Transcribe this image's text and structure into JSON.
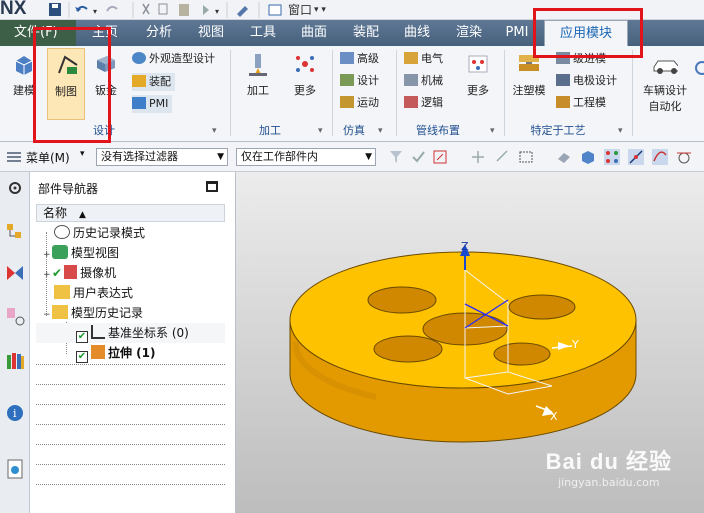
{
  "app": {
    "logo": "NX"
  },
  "quickbar": {
    "window_label": "窗口"
  },
  "tabs": {
    "file": "文件(F)",
    "items": [
      "主页",
      "分析",
      "视图",
      "工具",
      "曲面",
      "装配",
      "曲线",
      "渲染",
      "PMI",
      "应用模块"
    ],
    "active": "应用模块"
  },
  "ribbon": {
    "design_group": {
      "label": "设计",
      "buttons": [
        "建模",
        "制图",
        "钣金"
      ],
      "small": [
        "外观造型设计",
        "装配",
        "PMI"
      ]
    },
    "machining_group": {
      "label": "加工",
      "buttons": [
        "加工",
        "更多"
      ]
    },
    "simulation_group": {
      "label": "仿真",
      "small": [
        "高级",
        "设计",
        "运动"
      ]
    },
    "routing_group": {
      "label": "管线布置",
      "small": [
        "电气",
        "机械",
        "逻辑"
      ],
      "more": "更多"
    },
    "process_group": {
      "label": "特定于工艺",
      "big": "注塑模",
      "small": [
        "级进模",
        "电极设计",
        "工程模"
      ]
    },
    "vehicle": {
      "label_line1": "车辆设计",
      "label_line2": "自动化"
    }
  },
  "selection_bar": {
    "menu_label": "菜单(M)",
    "filter": "没有选择过滤器",
    "scope": "仅在工作部件内"
  },
  "navigator": {
    "title": "部件导航器",
    "column_name": "名称",
    "rows": [
      "历史记录模式",
      "模型视图",
      "摄像机",
      "用户表达式",
      "模型历史记录",
      "基准坐标系 (0)",
      "拉伸 (1)"
    ]
  },
  "viewport": {
    "axes": {
      "x": "X",
      "y": "Y",
      "z": "Z"
    }
  },
  "watermark": {
    "brand": "Bai du 经验",
    "url": "jingyan.baidu.com"
  },
  "colors": {
    "accent": "#1a66b3",
    "tab_bar": "#47607c",
    "file_tab": "#3e5f47",
    "part": "#f2b000",
    "highlight": "#e1141c"
  }
}
